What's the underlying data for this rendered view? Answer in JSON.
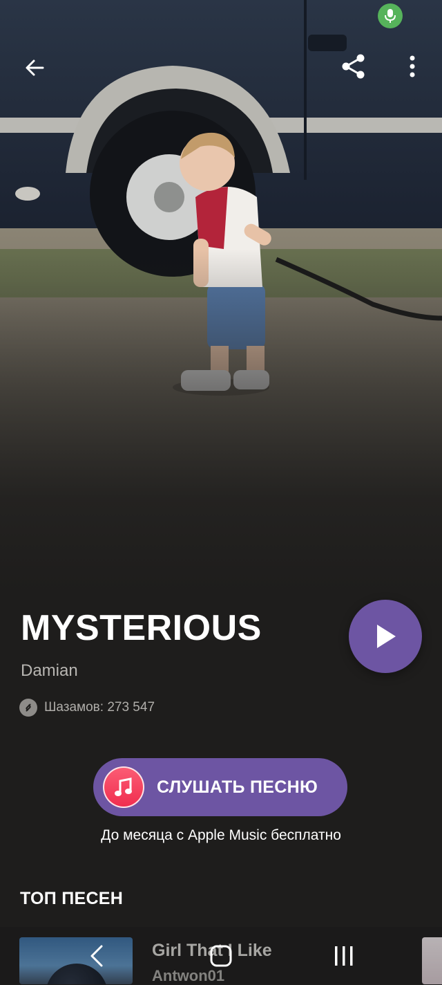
{
  "track": {
    "title": "MYSTERIOUS",
    "artist": "Damian",
    "shazams_text": "Шазамов: 273 547"
  },
  "actions": {
    "listen_label": "СЛУШАТЬ ПЕСНЮ",
    "promo_text": "До месяца с Apple Music бесплатно"
  },
  "top_songs": {
    "section_title": "ТОП ПЕСЕН",
    "items": [
      {
        "title": "Girl That I Like",
        "artist": "Antwon01"
      }
    ]
  },
  "icons": {
    "back": "arrow-left-icon",
    "share": "share-icon",
    "more": "more-vertical-icon",
    "mic": "microphone-icon",
    "play": "play-icon",
    "apple_music": "music-note-icon",
    "shazam": "shazam-logo-icon"
  },
  "colors": {
    "accent": "#6d55a3",
    "background": "#1e1d1c",
    "mic_indicator": "#56b35b",
    "apple_music": "#f02e4f"
  }
}
